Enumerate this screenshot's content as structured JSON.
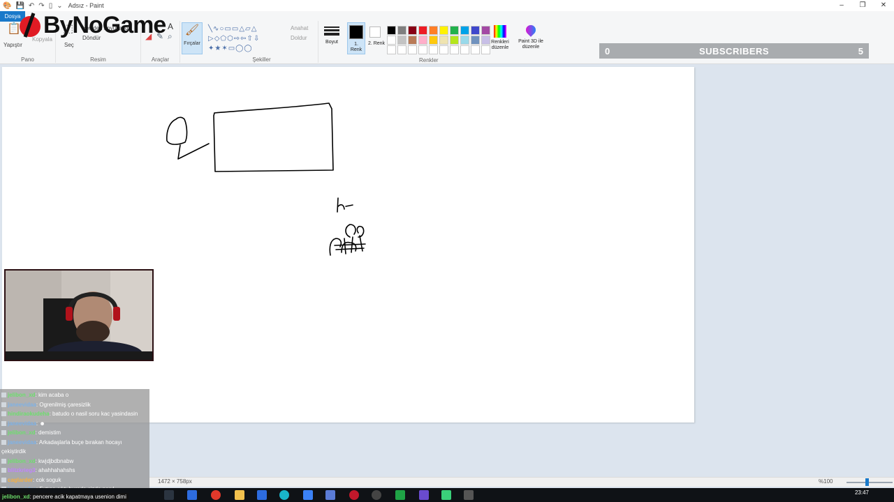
{
  "window": {
    "title": "Adsız - Paint",
    "controls": [
      "–",
      "❐",
      "✕"
    ]
  },
  "ribbon": {
    "file_tab": "Dosya",
    "groups": {
      "clipboard": {
        "label": "Pano",
        "paste": "Yapıştır",
        "copy": "Kopyala"
      },
      "image": {
        "label": "Resim",
        "select": "Seç",
        "resize": "Yeniden boyutlandır",
        "rotate": "Döndür"
      },
      "tools": {
        "label": "Araçlar"
      },
      "brushes": {
        "label": "Fırçalar"
      },
      "shapes": {
        "label": "Şekiller",
        "outline": "Anahat",
        "fill": "Doldur"
      },
      "size": {
        "label": "Boyut"
      },
      "colors": {
        "label": "Renkler",
        "color1": "1. Renk",
        "color2": "2. Renk",
        "edit_colors": "Renkleri düzenle",
        "paint3d": "Paint 3D ile düzenle",
        "palette": [
          "#000000",
          "#7f7f7f",
          "#880015",
          "#ed1c24",
          "#ff7f27",
          "#fff200",
          "#22b14c",
          "#00a2e8",
          "#3f48cc",
          "#a349a4",
          "#ffffff",
          "#c3c3c3",
          "#b97a57",
          "#ffaec9",
          "#ffc90e",
          "#efe4b0",
          "#b5e61d",
          "#99d9ea",
          "#7092be",
          "#c8bfe7",
          "#ffffff",
          "#ffffff",
          "#ffffff",
          "#ffffff",
          "#ffffff",
          "#ffffff",
          "#ffffff",
          "#ffffff",
          "#ffffff",
          "#ffffff"
        ],
        "primary": "#000000",
        "secondary": "#ffffff"
      }
    }
  },
  "logo": {
    "text": "ByNoGame",
    "accent": "#e01b24"
  },
  "subscribers": {
    "left": "0",
    "label": "SUBSCRIBERS",
    "right": "5"
  },
  "chat": [
    {
      "user": "jelibon_xd",
      "color": "#6ddf6d",
      "text": ": kim acaba o"
    },
    {
      "user": "janeevidaa",
      "color": "#7fb2e6",
      "text": ": Ogrenilmiş çaresizlik"
    },
    {
      "user": "hindiraokudeha",
      "color": "#6ddf6d",
      "text": ": batudo o nasil soru kac yasindasin"
    },
    {
      "user": "janeevidaa",
      "color": "#7fb2e6",
      "text": ": ☻"
    },
    {
      "user": "jelibon_xd",
      "color": "#6ddf6d",
      "text": ": demistim"
    },
    {
      "user": "janeevidaa",
      "color": "#7fb2e6",
      "text": ": Arkadaşlarla buçe bırakan hocayı"
    },
    {
      "user": "",
      "color": "#ffffff",
      "text": "çekiştirdik"
    },
    {
      "user": "jelibon_xd",
      "color": "#6ddf6d",
      "text": ": kwjdjbdbnabw"
    },
    {
      "user": "blitzkrieg3",
      "color": "#c084fc",
      "text": ": ahahhahahshs"
    },
    {
      "user": "caglarder",
      "color": "#f5b041",
      "text": ": cok soguk"
    },
    {
      "user": "janeevidaa",
      "color": "#7fb2e6",
      "text": ": Fırtına çıktı burada sizde nasıl"
    }
  ],
  "ticker": {
    "user": "jelibon_xd",
    "text": ": pencere acik kapatmaya usenion dimi"
  },
  "status": {
    "dimensions": "1472 × 758px",
    "zoom": "%100"
  },
  "taskbar": {
    "clock": "23:47"
  }
}
